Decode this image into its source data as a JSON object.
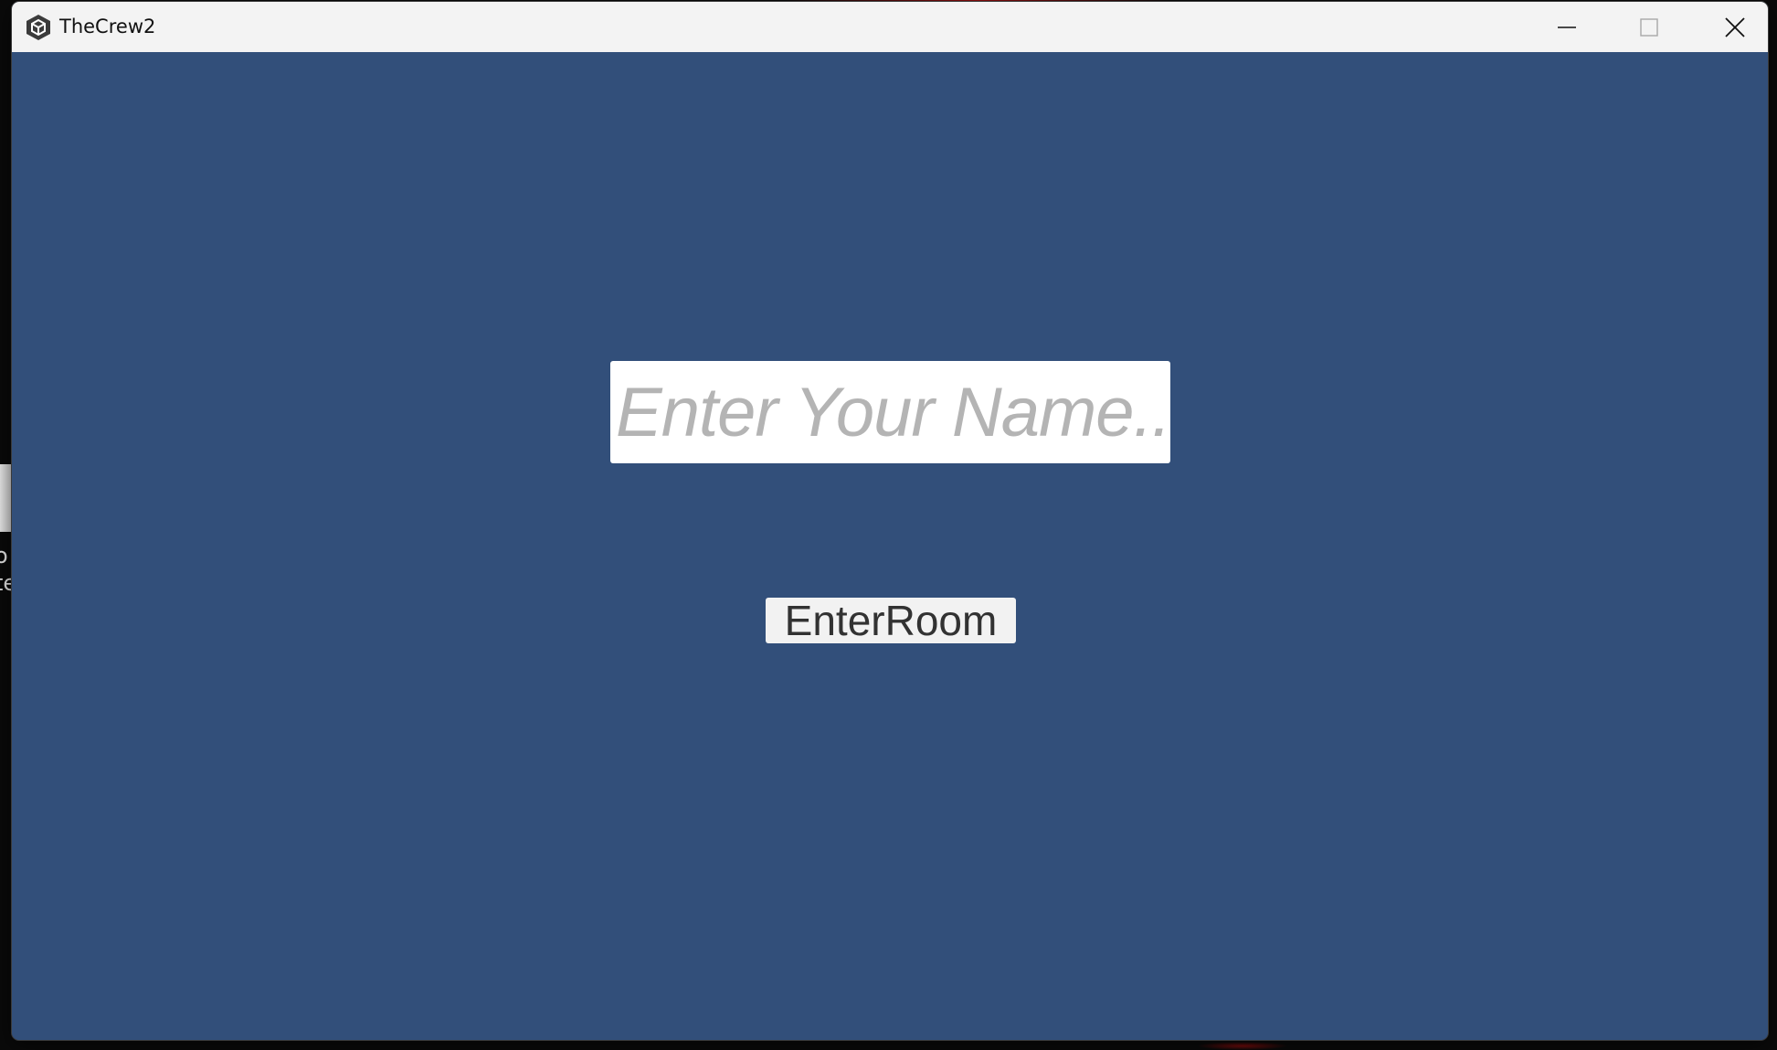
{
  "background": {
    "fragment_line_1": "o",
    "fragment_line_2": "te"
  },
  "window": {
    "title": "TheCrew2",
    "app_icon": "unity-cube-icon",
    "controls": {
      "minimize": "minimize-icon",
      "maximize": "maximize-icon",
      "close": "close-icon"
    }
  },
  "login": {
    "name_placeholder": "Enter Your Name...",
    "name_value": "",
    "enter_button_label": "EnterRoom"
  },
  "colors": {
    "client_background": "#324f7a",
    "titlebar": "#f3f3f3",
    "placeholder": "#b4b4b4",
    "button_bg": "#f2f2f2"
  }
}
